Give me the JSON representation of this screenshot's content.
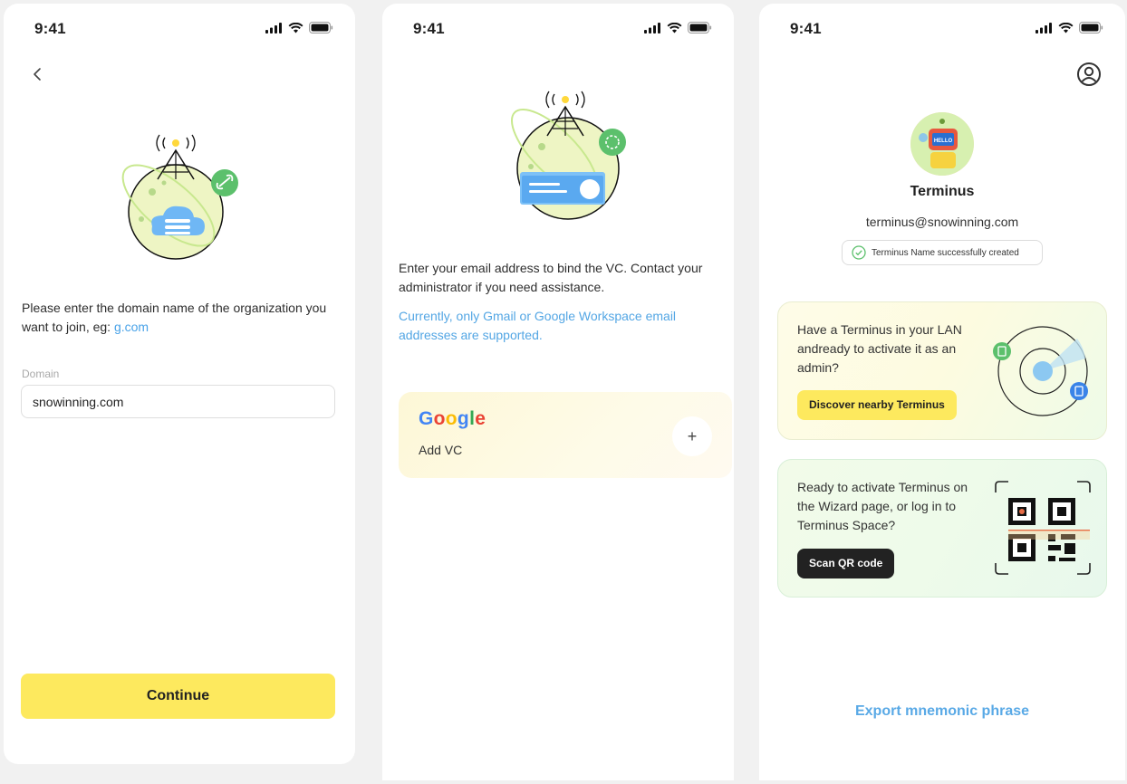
{
  "screen1": {
    "status_time": "9:41",
    "description": "Please enter the domain name of the organization you want to join, eg: ",
    "description_link": "g.com",
    "domain_label": "Domain",
    "domain_value": "snowinning.com",
    "continue_label": "Continue"
  },
  "screen2": {
    "status_time": "9:41",
    "description": "Enter your email address to bind the VC. Contact your administrator if you need assistance.",
    "note": "Currently, only Gmail or Google Workspace email addresses are supported.",
    "provider": "Google",
    "add_vc_label": "Add VC",
    "plus_label": "+"
  },
  "screen3": {
    "status_time": "9:41",
    "name": "Terminus",
    "email": "terminus@snowinning.com",
    "badge_text": "Terminus Name successfully created",
    "avatar_text": "HELLO",
    "lan_card_text": "Have a Terminus in your LAN andready to activate it as an admin?",
    "lan_card_button": "Discover nearby Terminus",
    "qr_card_text": "Ready to activate Terminus on the Wizard page, or log in to Terminus Space?",
    "qr_card_button": "Scan QR code",
    "export_label": "Export mnemonic phrase"
  },
  "colors": {
    "accent_yellow": "#fde95e",
    "link_blue": "#4aa3e8",
    "success_green": "#5cc06c"
  }
}
